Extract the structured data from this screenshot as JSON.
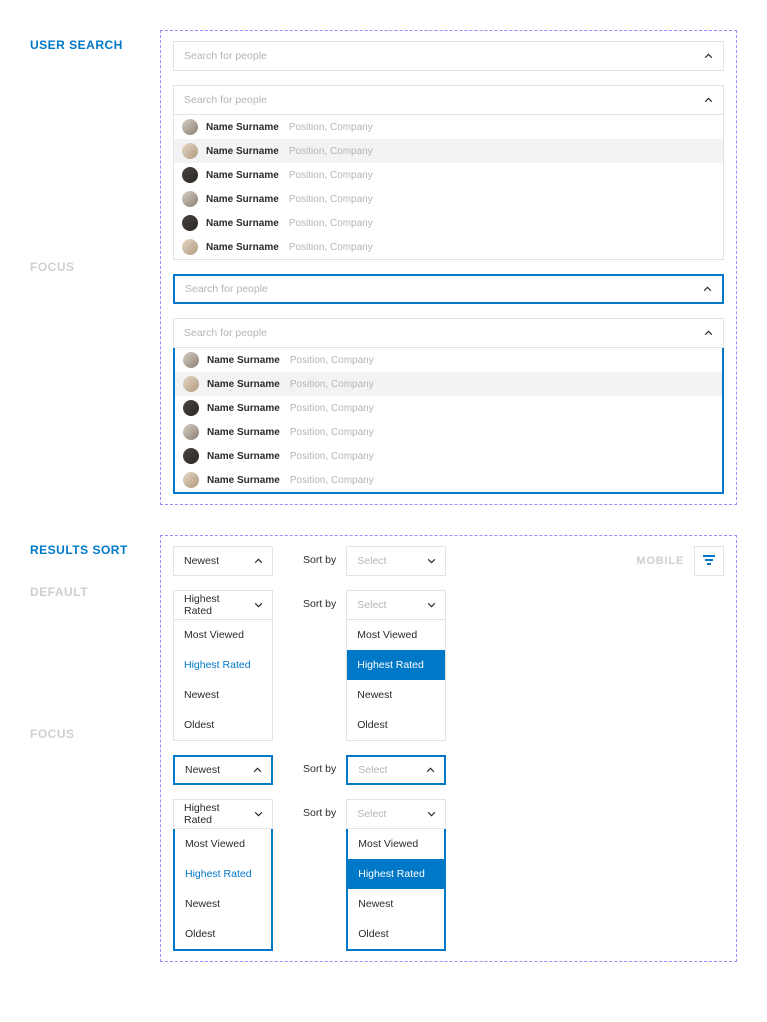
{
  "user_search": {
    "title": "USER SEARCH",
    "focus_title": "FOCUS",
    "placeholder": "Search for people",
    "people": [
      {
        "name": "Name Surname",
        "meta": "Position, Company"
      },
      {
        "name": "Name Surname",
        "meta": "Position, Company"
      },
      {
        "name": "Name Surname",
        "meta": "Position, Company"
      },
      {
        "name": "Name Surname",
        "meta": "Position, Company"
      },
      {
        "name": "Name Surname",
        "meta": "Position, Company"
      },
      {
        "name": "Name Surname",
        "meta": "Position, Company"
      }
    ]
  },
  "results_sort": {
    "title": "RESULTS SORT",
    "default_title": "DEFAULT",
    "focus_title": "FOCUS",
    "sort_by_label": "Sort by",
    "mobile_label": "MOBILE",
    "newest": "Newest",
    "highest_rated": "Highest Rated",
    "select_placeholder": "Select",
    "options": [
      "Most Viewed",
      "Highest Rated",
      "Newest",
      "Oldest"
    ]
  }
}
